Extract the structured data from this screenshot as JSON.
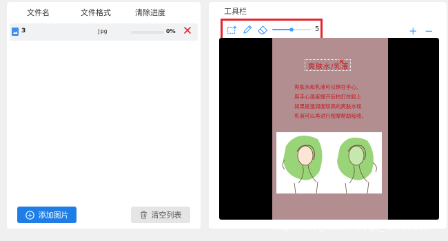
{
  "file_list": {
    "headers": {
      "name": "文件名",
      "format": "文件格式",
      "progress": "清除进度"
    },
    "rows": [
      {
        "name": "3",
        "format": "jpg",
        "progress_label": "0%",
        "progress_value": 0
      }
    ]
  },
  "buttons": {
    "add": "添加图片",
    "clear": "清空列表"
  },
  "toolbar": {
    "title": "工具栏",
    "brush_size": "5",
    "slider_value": 0.5,
    "highlight_color": "#e8232c",
    "icons": [
      "select-rect-icon",
      "pencil-icon",
      "eraser-icon"
    ],
    "zoom_in": "+",
    "zoom_out": "−"
  },
  "preview": {
    "title": "爽肤水/乳液",
    "lines": [
      "爽肤水和乳液可以倒在手心,",
      "用手心温度提开后拍打在脸上",
      "如果是温润度较高的爽肤水和",
      "乳液可以再进行按摩帮助吸收。"
    ]
  },
  "watermark": "https://blog.csdn.net/qq_42763389"
}
